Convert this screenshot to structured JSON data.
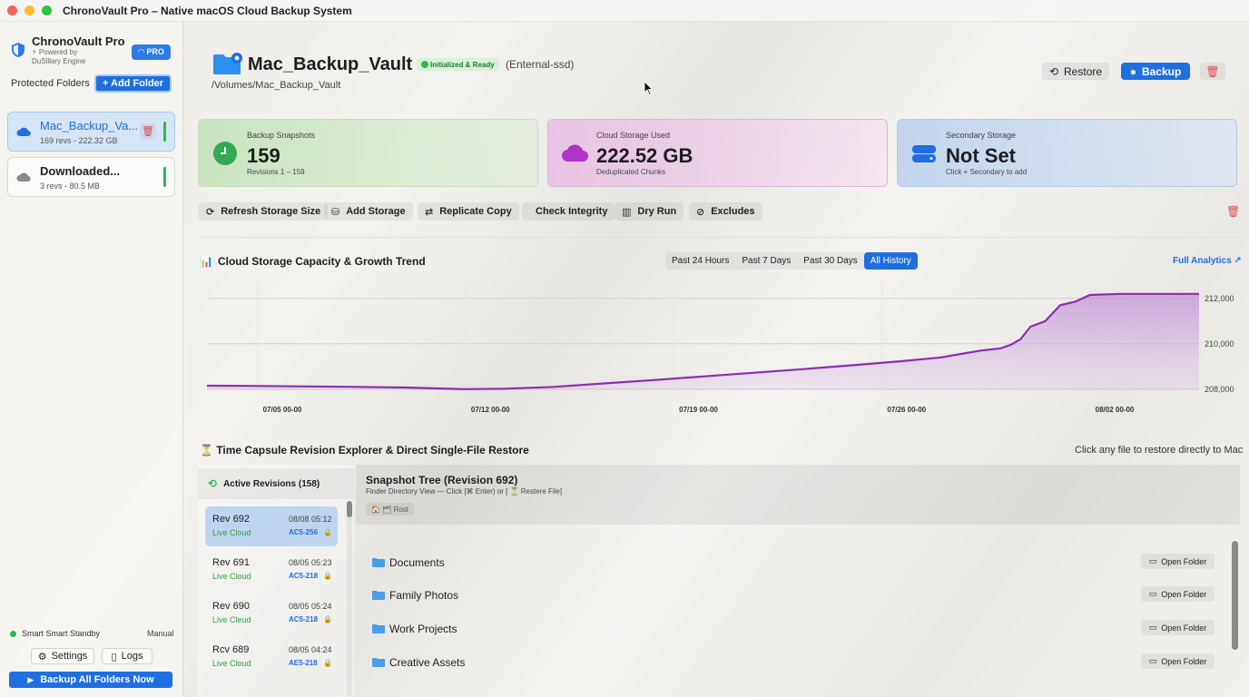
{
  "window": {
    "title": "ChronoVault Pro – Native macOS Cloud Backup System"
  },
  "sidebar": {
    "brand_name": "ChronoVault Pro",
    "brand_sub1": "⚡ Powered by",
    "brand_sub2": "DuSlllary Engine",
    "pro_badge": "PRO",
    "protected_label": "Protected Folders",
    "add_folder": "+ Add Folder",
    "folders": [
      {
        "name": "Mac_Backup_Va...",
        "sub": "169 revs - 222.32 GB",
        "trash": "🗑"
      },
      {
        "name": "Downloaded...",
        "sub": "3 revs - 80.5 MB"
      }
    ],
    "standby": "Smart Smart Standby",
    "standby_mode": "Manual",
    "settings": "Settings",
    "logs": "Logs",
    "backup_all": "Backup All Folders Now"
  },
  "header": {
    "vault_name": "Mac_Backup_Vault",
    "status": "Initialized & Ready",
    "drive_type": "(Enternal-ssd)",
    "path": "/Volumes/Mac_Backup_Vault",
    "restore": "Restore",
    "backup": "Backup",
    "delete": "🗑"
  },
  "stats": [
    {
      "label": "Backup Snapshots",
      "value": "159",
      "sub": "Revisions 1 – 159"
    },
    {
      "label": "Cloud Storage Used",
      "value": "222.52 GB",
      "sub": "Deduplicated Chunks"
    },
    {
      "label": "Secondary Storage",
      "value": "Not Set",
      "sub": "Click + Secondary to add"
    }
  ],
  "tools": [
    {
      "icon": "⟳",
      "label": "Refresh Storage Size"
    },
    {
      "icon": "⛁",
      "label": "Add Storage"
    },
    {
      "icon": "⇄",
      "label": "Replicate Copy"
    },
    {
      "icon": "",
      "label": "Check Integrity"
    },
    {
      "icon": "▥",
      "label": "Dry Run"
    },
    {
      "icon": "⊘",
      "label": "Excludes"
    }
  ],
  "chart": {
    "title_icon": "📊",
    "title": "Cloud Storage Capacity & Growth Trend",
    "ranges": [
      "Past 24 Hours",
      "Past 7 Days",
      "Past 30 Days",
      "All History"
    ],
    "active_range": "All History",
    "full_analytics": "Full Analytics ↗"
  },
  "chart_data": {
    "type": "area",
    "title": "Cloud Storage Capacity & Growth Trend",
    "xlabel": "",
    "ylabel": "",
    "x_ticks": [
      "07/05 00-00",
      "07/12 00-00",
      "07/19 00-00",
      "07/26 00-00",
      "08/02 00-00"
    ],
    "y_ticks": [
      208000,
      210000,
      212000
    ],
    "y_tick_labels": [
      "208,000",
      "210,000",
      "212,000"
    ],
    "ylim": [
      207950,
      212350
    ],
    "grid": true,
    "color": "#8e2db0",
    "series": [
      {
        "values": [
          [
            0.0,
            208150
          ],
          [
            0.05,
            208140
          ],
          [
            0.1,
            208120
          ],
          [
            0.15,
            208100
          ],
          [
            0.2,
            208070
          ],
          [
            0.26,
            208000
          ],
          [
            0.3,
            208020
          ],
          [
            0.35,
            208100
          ],
          [
            0.4,
            208250
          ],
          [
            0.45,
            208400
          ],
          [
            0.5,
            208560
          ],
          [
            0.55,
            208720
          ],
          [
            0.6,
            208880
          ],
          [
            0.65,
            209050
          ],
          [
            0.7,
            209230
          ],
          [
            0.74,
            209400
          ],
          [
            0.76,
            209550
          ],
          [
            0.78,
            209700
          ],
          [
            0.8,
            209800
          ],
          [
            0.81,
            209950
          ],
          [
            0.82,
            210200
          ],
          [
            0.83,
            210750
          ],
          [
            0.845,
            211000
          ],
          [
            0.86,
            211700
          ],
          [
            0.875,
            211850
          ],
          [
            0.89,
            212150
          ],
          [
            0.92,
            212200
          ],
          [
            1.0,
            212200
          ]
        ]
      }
    ]
  },
  "revisions": {
    "title": "⏳ Time Capsule Revision Explorer & Direct Single-File Restore",
    "hint": "Click any file to restore directly to Mac",
    "header": "Active Revisions (158)",
    "items": [
      {
        "name": "Rev 692",
        "date": "08/08 05:12",
        "loc": "Live Cloud",
        "hash": "AC5-256"
      },
      {
        "name": "Rev 691",
        "date": "08/05 05:23",
        "loc": "Live Cloud",
        "hash": "AC5-218"
      },
      {
        "name": "Rev 690",
        "date": "08/05 05:24",
        "loc": "Live Cleud",
        "hash": "AC5-218"
      },
      {
        "name": "Rcv 689",
        "date": "08/05 04:24",
        "loc": "Live Cloud",
        "hash": "AE5-218"
      }
    ]
  },
  "tree": {
    "title": "Snapshot Tree (Revision 692)",
    "sub": "Finder Directory View — Click [⌘ Enter) or [ ⏳ Restere File]",
    "crumb": "🏠 🗂 Rost",
    "open_label": "Open Folder",
    "files": [
      "Documents",
      "Family Photos",
      "Work Projects",
      "Creative Assets"
    ]
  }
}
